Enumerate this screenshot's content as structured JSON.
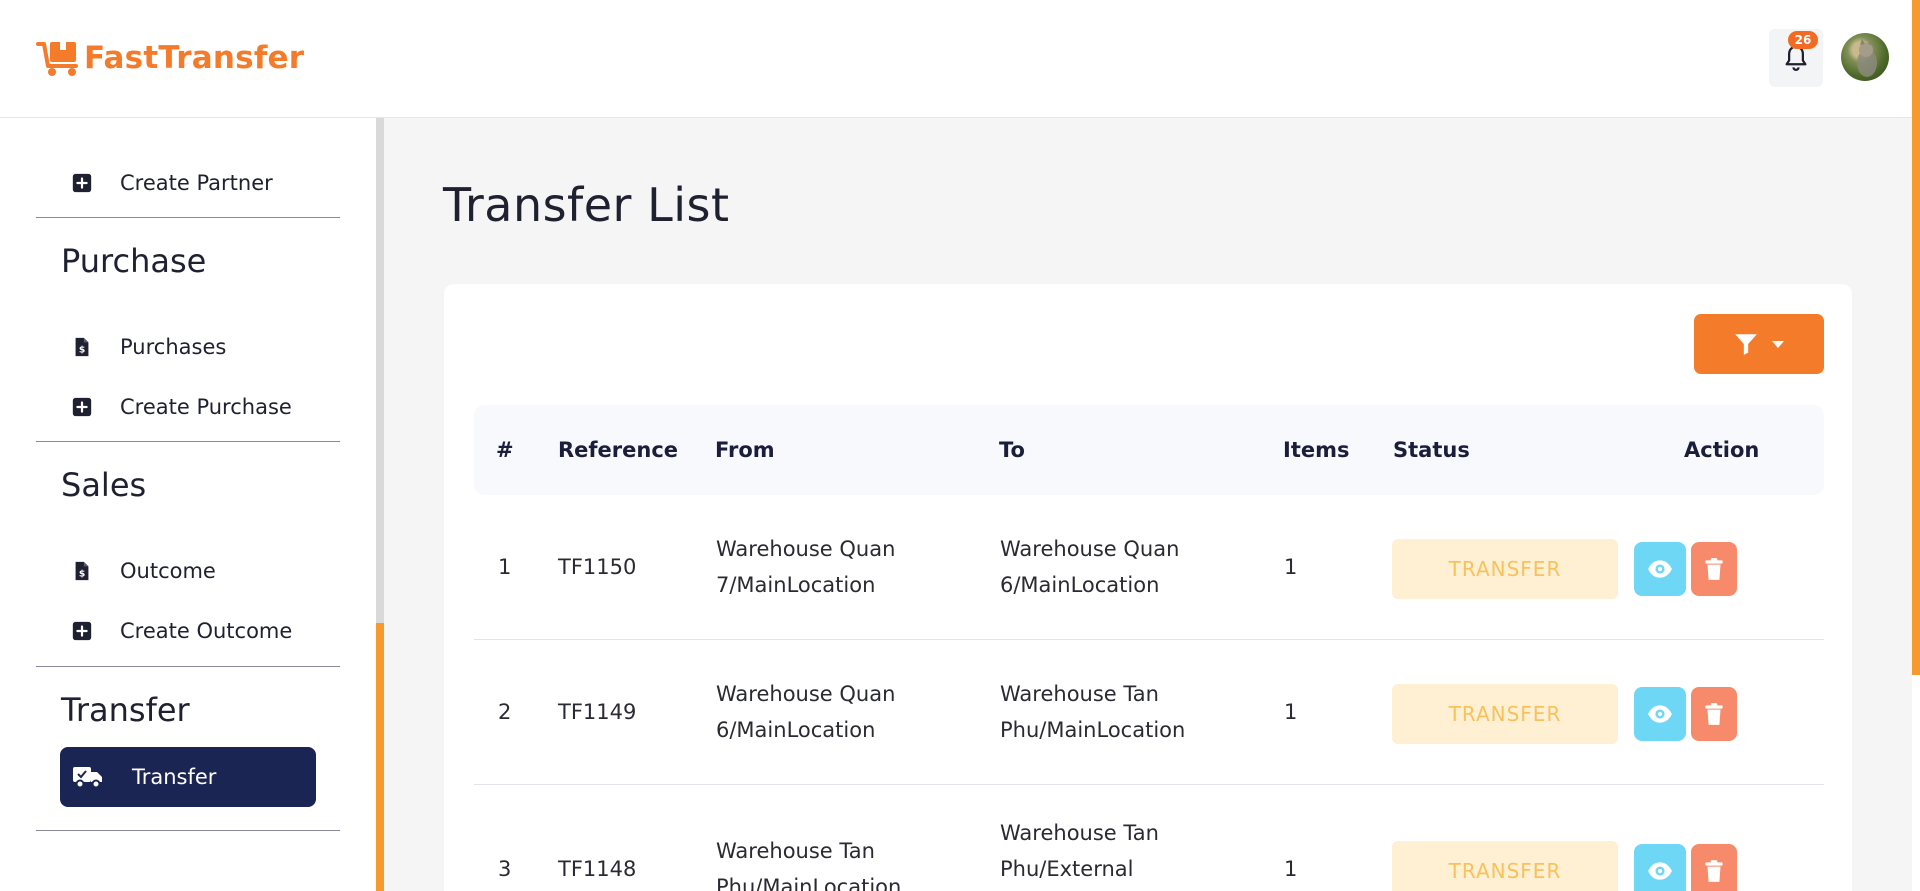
{
  "app": {
    "name": "FastTransfer",
    "brand_color": "#f47b2a"
  },
  "header": {
    "notification_count": "26"
  },
  "sidebar": {
    "items_top": [
      {
        "label": "Create Partner",
        "icon": "plus-square-icon"
      }
    ],
    "sections": [
      {
        "title": "Purchase",
        "items": [
          {
            "label": "Purchases",
            "icon": "invoice-dollar-icon"
          },
          {
            "label": "Create Purchase",
            "icon": "plus-square-icon"
          }
        ]
      },
      {
        "title": "Sales",
        "items": [
          {
            "label": "Outcome",
            "icon": "invoice-dollar-icon"
          },
          {
            "label": "Create Outcome",
            "icon": "plus-square-icon"
          }
        ]
      },
      {
        "title": "Transfer",
        "items": [
          {
            "label": "Transfer",
            "icon": "truck-icon",
            "active": true
          }
        ]
      }
    ]
  },
  "main": {
    "title": "Transfer List",
    "table": {
      "columns": [
        "#",
        "Reference",
        "From",
        "To",
        "Items",
        "Status",
        "Action"
      ],
      "rows": [
        {
          "num": "1",
          "reference": "TF1150",
          "from": [
            "Warehouse Quan",
            "7/MainLocation"
          ],
          "to": [
            "Warehouse Quan",
            "6/MainLocation"
          ],
          "items": "1",
          "status": "TRANSFER"
        },
        {
          "num": "2",
          "reference": "TF1149",
          "from": [
            "Warehouse Quan",
            "6/MainLocation"
          ],
          "to": [
            "Warehouse Tan",
            "Phu/MainLocation"
          ],
          "items": "1",
          "status": "TRANSFER"
        },
        {
          "num": "3",
          "reference": "TF1148",
          "from": [
            "Warehouse Tan",
            "Phu/MainLocation"
          ],
          "to": [
            "Warehouse Tan",
            "Phu/External"
          ],
          "items": "1",
          "status": "TRANSFER"
        }
      ]
    }
  }
}
